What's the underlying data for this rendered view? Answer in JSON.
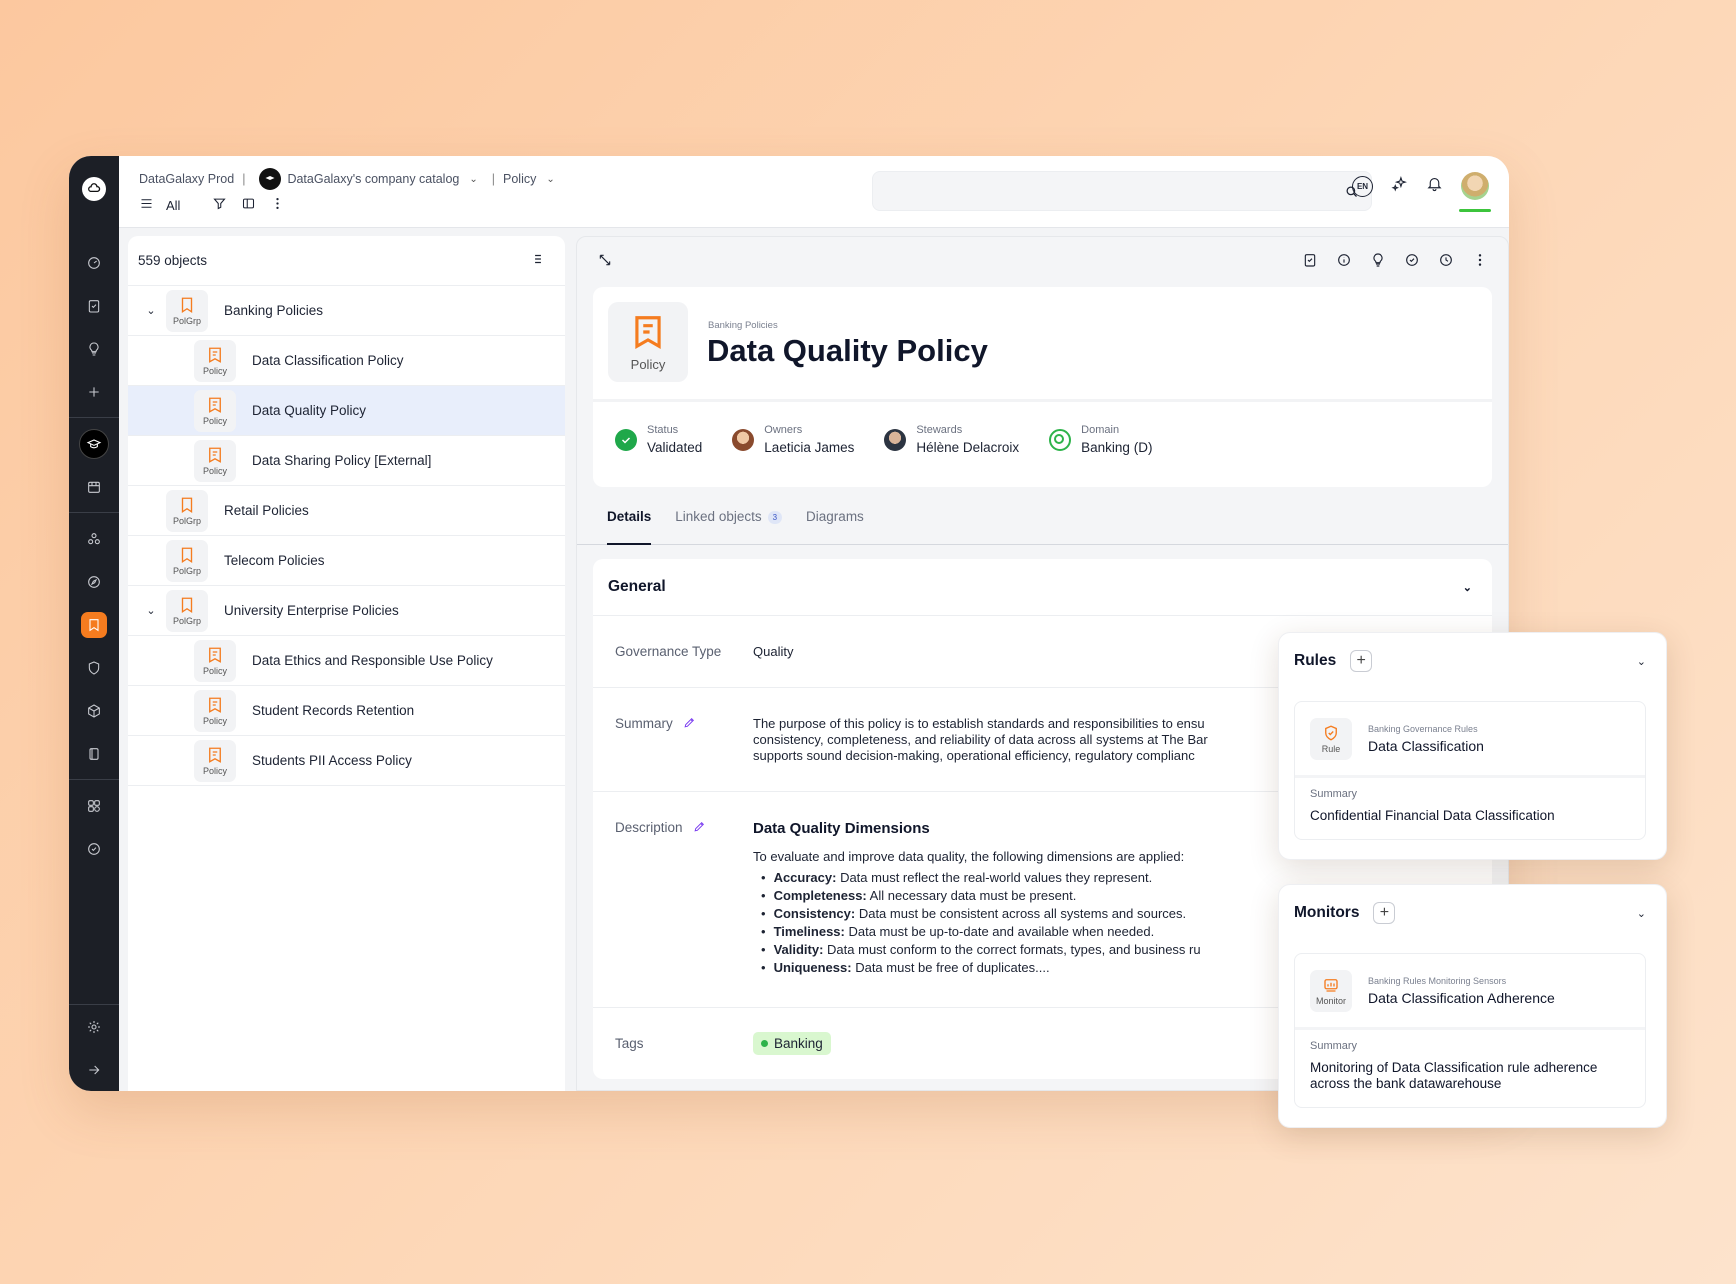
{
  "breadcrumb": {
    "workspace": "DataGalaxy Prod",
    "catalog": "DataGalaxy's company catalog",
    "module": "Policy"
  },
  "toolbar": {
    "filter_all": "All"
  },
  "search": {
    "placeholder": ""
  },
  "top_right": {
    "language": "EN"
  },
  "list": {
    "count": "559 objects",
    "items": [
      {
        "label": "Banking Policies",
        "type": "PolGrp",
        "level": 0,
        "expanded": true
      },
      {
        "label": "Data Classification Policy",
        "type": "Policy",
        "level": 1
      },
      {
        "label": "Data Quality Policy",
        "type": "Policy",
        "level": 1,
        "selected": true
      },
      {
        "label": "Data Sharing Policy [External]",
        "type": "Policy",
        "level": 1
      },
      {
        "label": "Retail Policies",
        "type": "PolGrp",
        "level": 0
      },
      {
        "label": "Telecom Policies",
        "type": "PolGrp",
        "level": 0
      },
      {
        "label": "University Enterprise Policies",
        "type": "PolGrp",
        "level": 0,
        "expanded": true
      },
      {
        "label": "Data Ethics and Responsible Use Policy",
        "type": "Policy",
        "level": 1
      },
      {
        "label": "Student Records Retention",
        "type": "Policy",
        "level": 1
      },
      {
        "label": "Students PII Access Policy",
        "type": "Policy",
        "level": 1
      }
    ]
  },
  "detail": {
    "icon_label": "Policy",
    "kicker": "Banking Policies",
    "title": "Data Quality Policy",
    "meta": {
      "status_label": "Status",
      "status_value": "Validated",
      "owners_label": "Owners",
      "owners_value": "Laeticia James",
      "stewards_label": "Stewards",
      "stewards_value": "Hélène Delacroix",
      "domain_label": "Domain",
      "domain_value": "Banking (D)"
    },
    "tabs": {
      "details": "Details",
      "linked": "Linked objects",
      "linked_count": "3",
      "diagrams": "Diagrams"
    },
    "general": {
      "title": "General",
      "governance_type_label": "Governance Type",
      "governance_type_value": "Quality",
      "summary_label": "Summary",
      "summary_lines": [
        "The purpose of this policy is to establish standards and responsibilities to ensu",
        "consistency, completeness, and reliability of data across all systems at The Bar",
        "supports sound decision-making, operational efficiency, regulatory complianc"
      ],
      "description_label": "Description",
      "description_heading": "Data Quality Dimensions",
      "description_intro": "To evaluate and improve data quality, the following dimensions are applied:",
      "dimensions": [
        {
          "name": "Accuracy:",
          "text": "Data must reflect the real-world values they represent."
        },
        {
          "name": "Completeness:",
          "text": "All necessary data must be present."
        },
        {
          "name": "Consistency:",
          "text": "Data must be consistent across all systems and sources."
        },
        {
          "name": "Timeliness:",
          "text": "Data must be up-to-date and available when needed."
        },
        {
          "name": "Validity:",
          "text": "Data must conform to the correct formats, types, and business ru"
        },
        {
          "name": "Uniqueness:",
          "text": "Data must be free of duplicates...."
        }
      ],
      "tags_label": "Tags",
      "tag_value": "Banking"
    }
  },
  "rules_card": {
    "title": "Rules",
    "item_type": "Rule",
    "item_kicker": "Banking Governance Rules",
    "item_title": "Data Classification",
    "summary_label": "Summary",
    "summary_value": "Confidential Financial Data Classification"
  },
  "monitors_card": {
    "title": "Monitors",
    "item_type": "Monitor",
    "item_kicker": "Banking Rules Monitoring Sensors",
    "item_title": "Data Classification Adherence",
    "summary_label": "Summary",
    "summary_value": "Monitoring of Data Classification rule adherence across the bank datawarehouse"
  },
  "colors": {
    "accent": "#f57c1f",
    "rail": "#1c1f26",
    "selected_row": "#e8eefb",
    "status_green": "#1fa84a",
    "edit_purple": "#7a3cf0"
  }
}
